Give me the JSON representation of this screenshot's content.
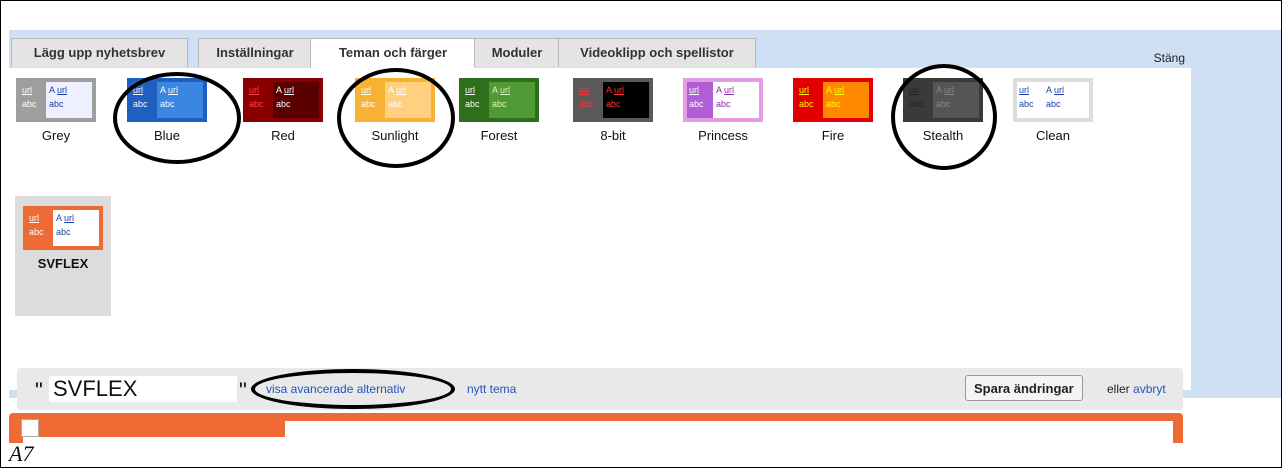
{
  "tabs": [
    {
      "label": "Lägg upp nyhetsbrev",
      "active": false
    },
    {
      "label": "Inställningar",
      "active": false
    },
    {
      "label": "Teman och färger",
      "active": true
    },
    {
      "label": "Moduler",
      "active": false
    },
    {
      "label": "Videoklipp och spellistor",
      "active": false
    }
  ],
  "close_label": "Stäng",
  "themes": [
    {
      "name": "Grey",
      "a": "A",
      "url": "url",
      "abc": "abc",
      "colors": {
        "border": "#9e9e9e",
        "left": "#9e9e9e",
        "right": "#eef0ff",
        "lt": "#ffffff",
        "rt": "#1a3faa"
      }
    },
    {
      "name": "Blue",
      "a": "A",
      "url": "url",
      "abc": "abc",
      "colors": {
        "border": "#1e5fbf",
        "left": "#1e5fbf",
        "right": "#3a86e0",
        "lt": "#ffffff",
        "rt": "#ffffff"
      }
    },
    {
      "name": "Red",
      "a": "A",
      "url": "url",
      "abc": "abc",
      "colors": {
        "border": "#8a0000",
        "left": "#8a0000",
        "right": "#5a0000",
        "lt": "#ff4444",
        "rt": "#ffffff"
      }
    },
    {
      "name": "Sunlight",
      "a": "A",
      "url": "url",
      "abc": "abc",
      "colors": {
        "border": "#f7b233",
        "left": "#f7b233",
        "right": "#ffd080",
        "lt": "#ffffff",
        "rt": "#ffffff"
      }
    },
    {
      "name": "Forest",
      "a": "A",
      "url": "url",
      "abc": "abc",
      "colors": {
        "border": "#2f6e1a",
        "left": "#2f6e1a",
        "right": "#4f9a35",
        "lt": "#ffffff",
        "rt": "#dff5c0"
      }
    },
    {
      "name": "8-bit",
      "a": "A",
      "url": "url",
      "abc": "abc",
      "colors": {
        "border": "#5a5a5a",
        "left": "#5a5a5a",
        "right": "#000000",
        "lt": "#ff3333",
        "rt": "#ff3333"
      }
    },
    {
      "name": "Princess",
      "a": "A",
      "url": "url",
      "abc": "abc",
      "colors": {
        "border": "#e69be6",
        "left": "#b05ed6",
        "right": "#ffffff",
        "lt": "#ffffff",
        "rt": "#8a2aa8"
      }
    },
    {
      "name": "Fire",
      "a": "A",
      "url": "url",
      "abc": "abc",
      "colors": {
        "border": "#e00000",
        "left": "#e00000",
        "right": "#ff8a00",
        "lt": "#ffff00",
        "rt": "#ffff00"
      }
    },
    {
      "name": "Stealth",
      "a": "A",
      "url": "url",
      "abc": "abc",
      "colors": {
        "border": "#3a3a3a",
        "left": "#3a3a3a",
        "right": "#555555",
        "lt": "#222222",
        "rt": "#888888"
      }
    },
    {
      "name": "Clean",
      "a": "A",
      "url": "url",
      "abc": "abc",
      "colors": {
        "border": "#dddddd",
        "left": "#ffffff",
        "right": "#ffffff",
        "lt": "#1a3faa",
        "rt": "#1a3faa"
      }
    },
    {
      "name": "SVFLEX",
      "a": "A",
      "url": "url",
      "abc": "abc",
      "selected": true,
      "colors": {
        "border": "#ee6b36",
        "left": "#ee6b36",
        "right": "#ffffff",
        "lt": "#ffffff",
        "rt": "#1a3faa"
      }
    }
  ],
  "bottom": {
    "quote_open": "\"",
    "theme_name_value": "SVFLEX",
    "quote_close": "\"",
    "advanced_link": "visa avancerade alternativ",
    "new_theme_link": "nytt tema",
    "save_label": "Spara ändringar",
    "or_text": "eller",
    "cancel_link": "avbryt"
  },
  "caption": "A7"
}
